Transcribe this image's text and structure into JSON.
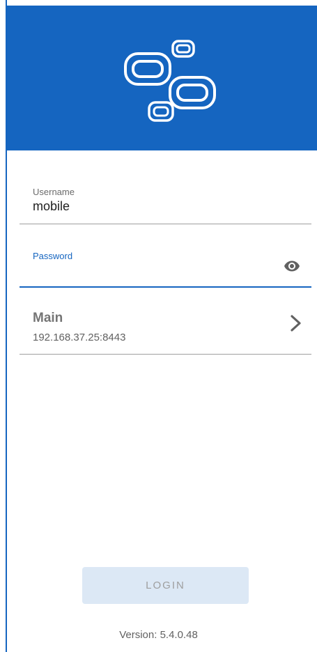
{
  "brand": {
    "logo_icon": "linked-rounded-rectangles-logo-icon",
    "header_color": "#1565c0"
  },
  "username": {
    "label": "Username",
    "value": "mobile"
  },
  "password": {
    "label": "Password",
    "value": "",
    "toggle_icon": "eye-icon",
    "focus_color": "#1565c0"
  },
  "server": {
    "name": "Main",
    "address": "192.168.37.25:8443",
    "chevron_icon": "chevron-right-icon"
  },
  "login": {
    "label": "LOGIN"
  },
  "version": "Version: 5.4.0.48"
}
